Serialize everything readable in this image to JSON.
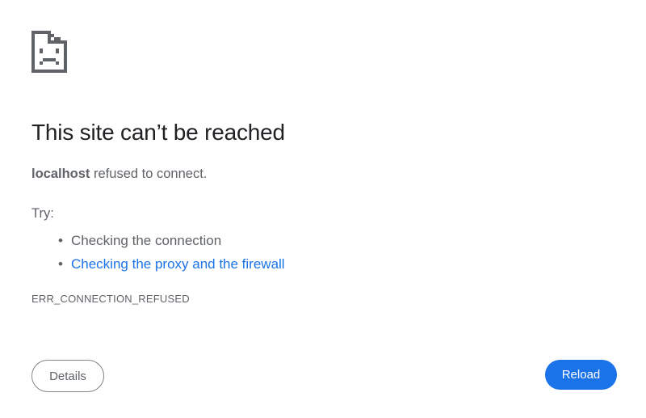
{
  "error": {
    "icon": "sad-page-icon",
    "title": "This site can’t be reached",
    "host": "localhost",
    "message": " refused to connect.",
    "try_label": "Try:",
    "suggestions": [
      {
        "text": "Checking the connection",
        "is_link": false
      },
      {
        "text": "Checking the proxy and the firewall",
        "is_link": true
      }
    ],
    "code": "ERR_CONNECTION_REFUSED"
  },
  "buttons": {
    "details_label": "Details",
    "reload_label": "Reload"
  },
  "colors": {
    "title": "#202124",
    "body_text": "#5f6368",
    "link": "#1a73e8",
    "primary_button": "#1a73e8",
    "icon": "#5f6368"
  }
}
